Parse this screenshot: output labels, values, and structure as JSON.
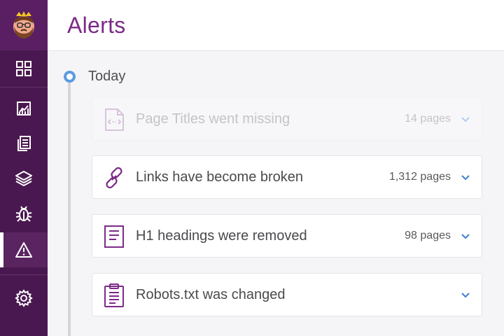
{
  "app": {
    "page_title": "Alerts",
    "accent_color": "#7b2a87",
    "sidebar_color": "#4a1850",
    "timeline_color": "#5b9be0"
  },
  "sidebar": {
    "items": [
      {
        "name": "dashboard",
        "icon": "grid-icon",
        "active": false
      },
      {
        "name": "reports",
        "icon": "chart-icon",
        "active": false
      },
      {
        "name": "pages",
        "icon": "pages-icon",
        "active": false
      },
      {
        "name": "layers",
        "icon": "layers-icon",
        "active": false
      },
      {
        "name": "issues",
        "icon": "bug-icon",
        "active": false
      },
      {
        "name": "alerts",
        "icon": "warning-icon",
        "active": true
      },
      {
        "name": "settings",
        "icon": "gear-icon",
        "active": false
      }
    ]
  },
  "timeline": {
    "day_label": "Today",
    "alerts": [
      {
        "icon": "code-file-icon",
        "text": "Page Titles went missing",
        "count": "14 pages",
        "faded": true
      },
      {
        "icon": "broken-link-icon",
        "text": "Links have become broken",
        "count": "1,312 pages",
        "faded": false
      },
      {
        "icon": "document-icon",
        "text": "H1 headings were removed",
        "count": "98 pages",
        "faded": false
      },
      {
        "icon": "clipboard-icon",
        "text": "Robots.txt was changed",
        "count": "",
        "faded": false
      }
    ]
  }
}
